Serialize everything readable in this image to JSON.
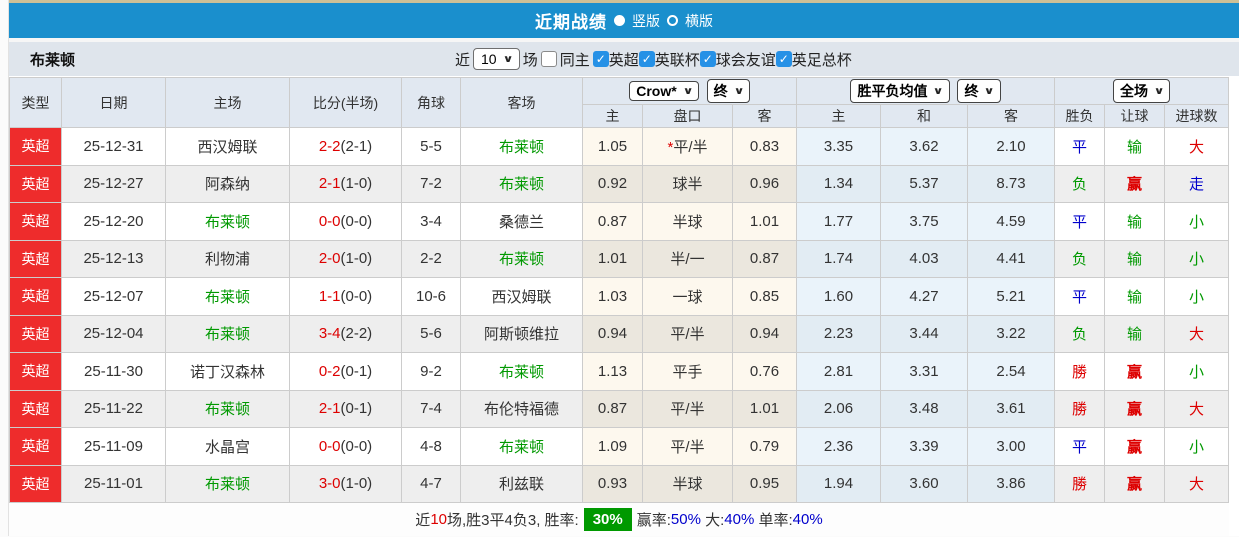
{
  "title_bar": {
    "title": "近期战绩",
    "radio_vertical": "竖版",
    "radio_horizontal": "横版"
  },
  "filter_bar": {
    "team": "布莱顿",
    "near_label": "近",
    "near_value": "10",
    "games_label": "场",
    "same_home_label": "同主",
    "leagues": [
      "英超",
      "英联杯",
      "球会友谊",
      "英足总杯"
    ]
  },
  "table": {
    "static_headers": [
      "类型",
      "日期",
      "主场",
      "比分(半场)",
      "角球",
      "客场"
    ],
    "selects": {
      "odds_company": "Crow*",
      "odds_company_state": "终",
      "avg_label": "胜平负均值",
      "avg_state": "终",
      "scope": "全场"
    },
    "sub_headers": [
      "主",
      "盘口",
      "客",
      "主",
      "和",
      "客",
      "胜负",
      "让球",
      "进球数"
    ],
    "rows": [
      {
        "type": "英超",
        "date": "25-12-31",
        "home": {
          "text": "西汉姆联",
          "green": false
        },
        "score_full": "2-2",
        "score_half": "(2-1)",
        "corners": "5-5",
        "away": {
          "text": "布莱顿",
          "green": true
        },
        "crow": {
          "home": "1.05",
          "star": true,
          "handicap": "平/半",
          "away": "0.83"
        },
        "avg": {
          "home": "3.35",
          "draw": "3.62",
          "away": "2.10"
        },
        "results": [
          {
            "text": "平",
            "color": "blue"
          },
          {
            "text": "输",
            "color": "green"
          },
          {
            "text": "大",
            "color": "red"
          }
        ]
      },
      {
        "type": "英超",
        "date": "25-12-27",
        "home": {
          "text": "阿森纳",
          "green": false
        },
        "score_full": "2-1",
        "score_half": "(1-0)",
        "corners": "7-2",
        "away": {
          "text": "布莱顿",
          "green": true
        },
        "crow": {
          "home": "0.92",
          "star": false,
          "handicap": "球半",
          "away": "0.96"
        },
        "avg": {
          "home": "1.34",
          "draw": "5.37",
          "away": "8.73"
        },
        "results": [
          {
            "text": "负",
            "color": "green"
          },
          {
            "text": "赢",
            "color": "red",
            "bold": true
          },
          {
            "text": "走",
            "color": "blue"
          }
        ]
      },
      {
        "type": "英超",
        "date": "25-12-20",
        "home": {
          "text": "布莱顿",
          "green": true
        },
        "score_full": "0-0",
        "score_half": "(0-0)",
        "corners": "3-4",
        "away": {
          "text": "桑德兰",
          "green": false
        },
        "crow": {
          "home": "0.87",
          "star": false,
          "handicap": "半球",
          "away": "1.01"
        },
        "avg": {
          "home": "1.77",
          "draw": "3.75",
          "away": "4.59"
        },
        "results": [
          {
            "text": "平",
            "color": "blue"
          },
          {
            "text": "输",
            "color": "green"
          },
          {
            "text": "小",
            "color": "green"
          }
        ]
      },
      {
        "type": "英超",
        "date": "25-12-13",
        "home": {
          "text": "利物浦",
          "green": false
        },
        "score_full": "2-0",
        "score_half": "(1-0)",
        "corners": "2-2",
        "away": {
          "text": "布莱顿",
          "green": true
        },
        "crow": {
          "home": "1.01",
          "star": false,
          "handicap": "半/一",
          "away": "0.87"
        },
        "avg": {
          "home": "1.74",
          "draw": "4.03",
          "away": "4.41"
        },
        "results": [
          {
            "text": "负",
            "color": "green"
          },
          {
            "text": "输",
            "color": "green"
          },
          {
            "text": "小",
            "color": "green"
          }
        ]
      },
      {
        "type": "英超",
        "date": "25-12-07",
        "home": {
          "text": "布莱顿",
          "green": true
        },
        "score_full": "1-1",
        "score_half": "(0-0)",
        "corners": "10-6",
        "away": {
          "text": "西汉姆联",
          "green": false
        },
        "crow": {
          "home": "1.03",
          "star": false,
          "handicap": "一球",
          "away": "0.85"
        },
        "avg": {
          "home": "1.60",
          "draw": "4.27",
          "away": "5.21"
        },
        "results": [
          {
            "text": "平",
            "color": "blue"
          },
          {
            "text": "输",
            "color": "green"
          },
          {
            "text": "小",
            "color": "green"
          }
        ]
      },
      {
        "type": "英超",
        "date": "25-12-04",
        "home": {
          "text": "布莱顿",
          "green": true
        },
        "score_full": "3-4",
        "score_half": "(2-2)",
        "corners": "5-6",
        "away": {
          "text": "阿斯顿维拉",
          "green": false
        },
        "crow": {
          "home": "0.94",
          "star": false,
          "handicap": "平/半",
          "away": "0.94"
        },
        "avg": {
          "home": "2.23",
          "draw": "3.44",
          "away": "3.22"
        },
        "results": [
          {
            "text": "负",
            "color": "green"
          },
          {
            "text": "输",
            "color": "green"
          },
          {
            "text": "大",
            "color": "red"
          }
        ]
      },
      {
        "type": "英超",
        "date": "25-11-30",
        "home": {
          "text": "诺丁汉森林",
          "green": false
        },
        "score_full": "0-2",
        "score_half": "(0-1)",
        "corners": "9-2",
        "away": {
          "text": "布莱顿",
          "green": true
        },
        "crow": {
          "home": "1.13",
          "star": false,
          "handicap": "平手",
          "away": "0.76"
        },
        "avg": {
          "home": "2.81",
          "draw": "3.31",
          "away": "2.54"
        },
        "results": [
          {
            "text": "勝",
            "color": "red"
          },
          {
            "text": "赢",
            "color": "red",
            "bold": true
          },
          {
            "text": "小",
            "color": "green"
          }
        ]
      },
      {
        "type": "英超",
        "date": "25-11-22",
        "home": {
          "text": "布莱顿",
          "green": true
        },
        "score_full": "2-1",
        "score_half": "(0-1)",
        "corners": "7-4",
        "away": {
          "text": "布伦特福德",
          "green": false
        },
        "crow": {
          "home": "0.87",
          "star": false,
          "handicap": "平/半",
          "away": "1.01"
        },
        "avg": {
          "home": "2.06",
          "draw": "3.48",
          "away": "3.61"
        },
        "results": [
          {
            "text": "勝",
            "color": "red"
          },
          {
            "text": "赢",
            "color": "red",
            "bold": true
          },
          {
            "text": "大",
            "color": "red"
          }
        ]
      },
      {
        "type": "英超",
        "date": "25-11-09",
        "home": {
          "text": "水晶宫",
          "green": false
        },
        "score_full": "0-0",
        "score_half": "(0-0)",
        "corners": "4-8",
        "away": {
          "text": "布莱顿",
          "green": true
        },
        "crow": {
          "home": "1.09",
          "star": false,
          "handicap": "平/半",
          "away": "0.79"
        },
        "avg": {
          "home": "2.36",
          "draw": "3.39",
          "away": "3.00"
        },
        "results": [
          {
            "text": "平",
            "color": "blue"
          },
          {
            "text": "赢",
            "color": "red",
            "bold": true
          },
          {
            "text": "小",
            "color": "green"
          }
        ]
      },
      {
        "type": "英超",
        "date": "25-11-01",
        "home": {
          "text": "布莱顿",
          "green": true
        },
        "score_full": "3-0",
        "score_half": "(1-0)",
        "corners": "4-7",
        "away": {
          "text": "利兹联",
          "green": false
        },
        "crow": {
          "home": "0.93",
          "star": false,
          "handicap": "半球",
          "away": "0.95"
        },
        "avg": {
          "home": "1.94",
          "draw": "3.60",
          "away": "3.86"
        },
        "results": [
          {
            "text": "勝",
            "color": "red"
          },
          {
            "text": "赢",
            "color": "red",
            "bold": true
          },
          {
            "text": "大",
            "color": "red"
          }
        ]
      }
    ]
  },
  "footer": {
    "segments": [
      {
        "text": "近",
        "style": "black"
      },
      {
        "text": "10",
        "style": "red"
      },
      {
        "text": "场,胜3平4负3, 胜率:",
        "style": "black"
      },
      {
        "text": "30%",
        "style": "badge"
      },
      {
        "text": "赢率:",
        "style": "black"
      },
      {
        "text": "50%",
        "style": "blue"
      },
      {
        "text": " 大:",
        "style": "black"
      },
      {
        "text": "40%",
        "style": "blue"
      },
      {
        "text": " 单率:",
        "style": "black"
      },
      {
        "text": "40%",
        "style": "blue"
      }
    ]
  },
  "colors": {
    "title_bar_bg": "#1a8fcd",
    "league_badge_bg": "#ee2c2c",
    "win_red": "#dd0000",
    "loss_green": "#009900",
    "draw_blue": "#0000cc",
    "badge_green_bg": "#009900",
    "checkbox_blue": "#2691e6"
  }
}
